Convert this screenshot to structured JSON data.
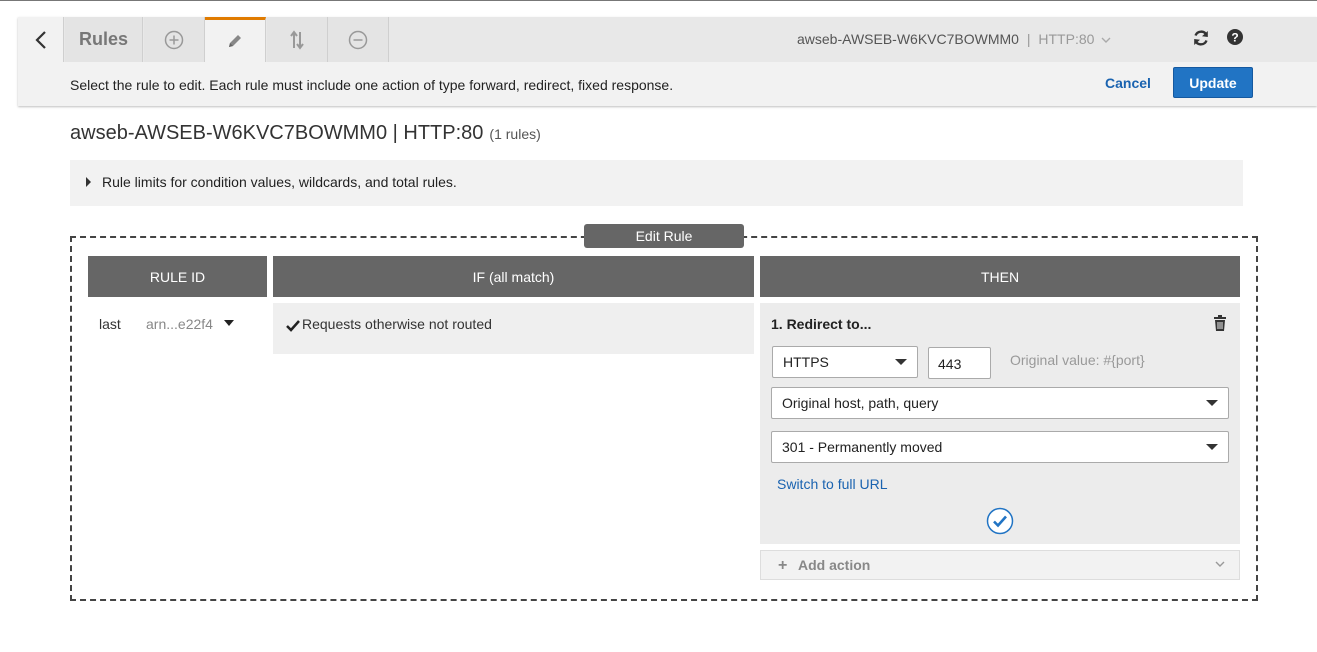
{
  "header": {
    "tabs": {
      "rules_label": "Rules"
    },
    "icons": [
      "back-chevron-icon",
      "plus-circle-icon",
      "pencil-icon",
      "reorder-arrows-icon",
      "minus-circle-icon",
      "refresh-icon",
      "help-icon"
    ],
    "load_balancer": "awseb-AWSEB-W6KVC7BOWMM0",
    "separator": "|",
    "listener": "HTTP:80",
    "instructions": "Select the rule to edit. Each rule must include one action of type forward, redirect, fixed response.",
    "cancel_label": "Cancel",
    "update_label": "Update"
  },
  "page": {
    "title": "awseb-AWSEB-W6KVC7BOWMM0 | HTTP:80",
    "rule_count": "(1 rules)",
    "limits_text": "Rule limits for condition values, wildcards, and total rules."
  },
  "edit_rule": {
    "label": "Edit Rule",
    "columns": {
      "rule_id": "RULE ID",
      "if": "IF (all match)",
      "then": "THEN"
    },
    "rule": {
      "priority": "last",
      "arn": "arn...e22f4",
      "condition": "Requests otherwise not routed"
    },
    "action": {
      "title": "1. Redirect to...",
      "protocol": "HTTPS",
      "port": "443",
      "port_hint": "Original value: #{port}",
      "host_path_query": "Original host, path, query",
      "status_code": "301 - Permanently moved",
      "switch_link": "Switch to full URL"
    },
    "add_action_label": "Add action"
  },
  "colors": {
    "accent_tab": "#e07b00",
    "primary_button": "#2174c4",
    "link": "#1a63b0",
    "column_header": "#666666"
  }
}
